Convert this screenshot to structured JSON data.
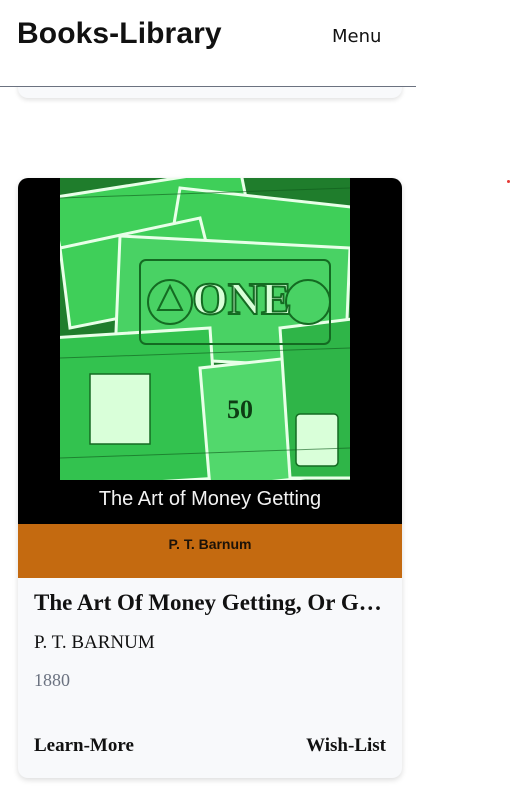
{
  "header": {
    "brand": "Books-Library",
    "menu_label": "Menu"
  },
  "book": {
    "cover": {
      "title": "The Art of Money Getting",
      "author": "P. T. Barnum",
      "banknote_text": "ONE",
      "banknote_number": "50",
      "art_icon": "dollar-bills-illustration",
      "colors": {
        "background": "#000000",
        "money_green": "#2fbf4a",
        "author_band": "#c46a10"
      }
    },
    "title": "The Art Of Money Getting, Or Golden Rules for Making Money",
    "author": "P. T. BARNUM",
    "year": "1880",
    "learn_more_label": "Learn-More",
    "wish_list_label": "Wish-List"
  }
}
